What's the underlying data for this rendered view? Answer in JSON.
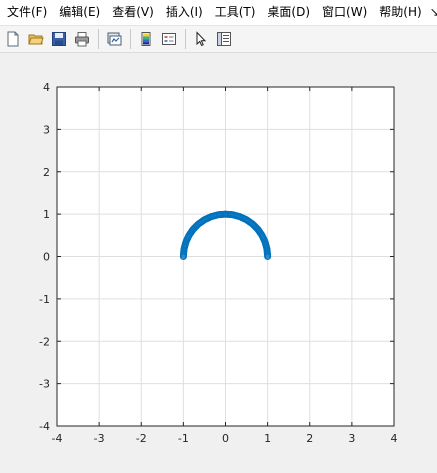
{
  "menu": {
    "items": [
      {
        "label": "文件(F)",
        "name": "menu-file"
      },
      {
        "label": "编辑(E)",
        "name": "menu-edit"
      },
      {
        "label": "查看(V)",
        "name": "menu-view"
      },
      {
        "label": "插入(I)",
        "name": "menu-insert"
      },
      {
        "label": "工具(T)",
        "name": "menu-tools"
      },
      {
        "label": "桌面(D)",
        "name": "menu-desktop"
      },
      {
        "label": "窗口(W)",
        "name": "menu-window"
      },
      {
        "label": "帮助(H)",
        "name": "menu-help"
      }
    ],
    "overflow": "↘"
  },
  "toolbar": {
    "buttons": [
      {
        "name": "new-figure-button",
        "icon": "new-file-icon"
      },
      {
        "name": "open-file-button",
        "icon": "open-folder-icon"
      },
      {
        "name": "save-figure-button",
        "icon": "save-disk-icon"
      },
      {
        "name": "print-figure-button",
        "icon": "printer-icon"
      },
      {
        "name": "link-plot-button",
        "icon": "link-plot-icon"
      },
      {
        "name": "insert-colorbar-button",
        "icon": "colorbar-icon"
      },
      {
        "name": "insert-legend-button",
        "icon": "legend-icon"
      },
      {
        "name": "edit-plot-button",
        "icon": "pointer-arrow-icon"
      },
      {
        "name": "property-inspector-button",
        "icon": "property-inspector-icon"
      }
    ]
  },
  "chart_data": {
    "type": "scatter",
    "title": "",
    "xlabel": "",
    "ylabel": "",
    "xlim": [
      -4,
      4
    ],
    "ylim": [
      -4,
      4
    ],
    "xticks": [
      "-4",
      "-3",
      "-2",
      "-1",
      "0",
      "1",
      "2",
      "3",
      "4"
    ],
    "yticks": [
      "4",
      "3",
      "2",
      "1",
      "0",
      "-1",
      "-2",
      "-3",
      "-4"
    ],
    "grid": true,
    "marker": "circle",
    "color": "#0072bd",
    "series": [
      {
        "curve": "upper semicircle of radius 1 centered at origin",
        "x": [
          1.0,
          0.9848,
          0.9397,
          0.866,
          0.766,
          0.6428,
          0.5,
          0.342,
          0.1736,
          0.0,
          -0.1736,
          -0.342,
          -0.5,
          -0.6428,
          -0.766,
          -0.866,
          -0.9397,
          -0.9848,
          -1.0
        ],
        "y": [
          0.0,
          0.1736,
          0.342,
          0.5,
          0.6428,
          0.766,
          0.866,
          0.9397,
          0.9848,
          1.0,
          0.9848,
          0.9397,
          0.866,
          0.766,
          0.6428,
          0.5,
          0.342,
          0.1736,
          0.0
        ]
      }
    ]
  }
}
